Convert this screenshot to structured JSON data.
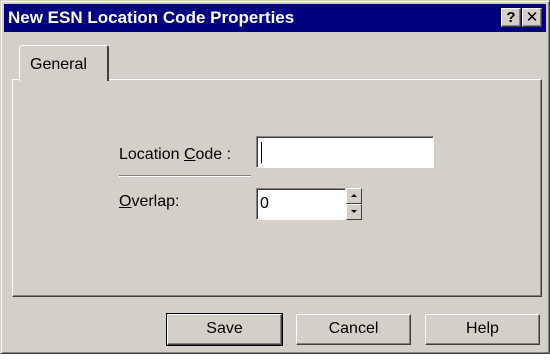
{
  "window": {
    "title": "New ESN Location Code Properties",
    "help_glyph": "?",
    "close_glyph": "✕"
  },
  "tabs": [
    {
      "label": "General",
      "selected": true
    }
  ],
  "form": {
    "location_code": {
      "label_before": "Location ",
      "label_accel": "C",
      "label_after": "ode :",
      "value": ""
    },
    "overlap": {
      "label_accel": "O",
      "label_after": "verlap:",
      "value": "0"
    }
  },
  "buttons": {
    "save": "Save",
    "cancel": "Cancel",
    "help": "Help"
  }
}
